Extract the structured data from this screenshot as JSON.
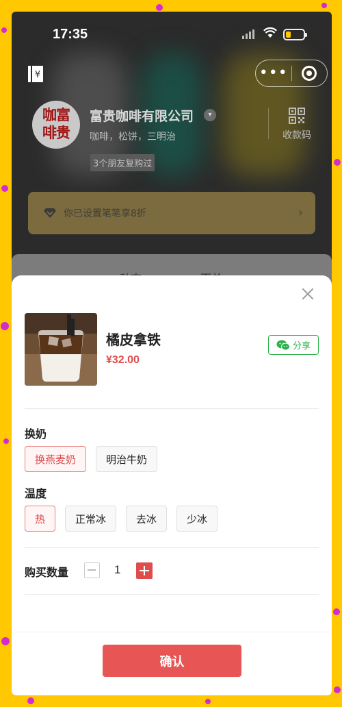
{
  "status_bar": {
    "time": "17:35"
  },
  "shop": {
    "logo_text": "咖富\n啡贵",
    "name": "富贵咖啡有限公司",
    "description": "咖啡，松饼，三明治",
    "friends_badge": "3个朋友复购过",
    "qr_label": "收款码"
  },
  "discount": {
    "text": "你已设置笔笔享8折"
  },
  "under_tabs": {
    "tab1": "动态",
    "tab2": "下单"
  },
  "product": {
    "name": "橘皮拿铁",
    "price": "¥32.00",
    "share_label": "分享"
  },
  "options": {
    "milk": {
      "title": "换奶",
      "choices": [
        "换燕麦奶",
        "明治牛奶"
      ],
      "selected": "换燕麦奶"
    },
    "temperature": {
      "title": "温度",
      "choices": [
        "热",
        "正常冰",
        "去冰",
        "少冰"
      ],
      "selected": "热"
    }
  },
  "quantity": {
    "label": "购买数量",
    "value": "1"
  },
  "confirm_label": "确认",
  "colors": {
    "accent": "#e04b4b",
    "share_green": "#2bb24c",
    "frame_yellow": "#ffc800"
  },
  "icons": [
    "ledger-icon",
    "more-icon",
    "close-mini-program-icon",
    "chevron-down-icon",
    "qr-code-icon",
    "diamond-icon",
    "chevron-right-icon",
    "close-icon",
    "wechat-icon",
    "minus-icon",
    "plus-icon"
  ]
}
